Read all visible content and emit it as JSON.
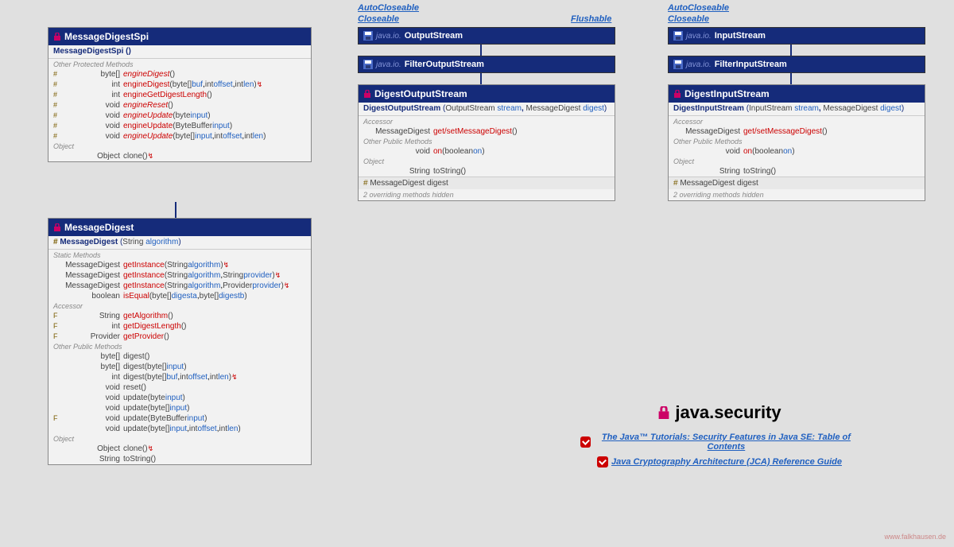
{
  "interfaces": {
    "autoCloseable1": "AutoCloseable",
    "closeable1": "Closeable",
    "flushable": "Flushable",
    "autoCloseable2": "AutoCloseable",
    "closeable2": "Closeable"
  },
  "parents": {
    "outputStream": {
      "pkg": "java.io.",
      "cls": "OutputStream"
    },
    "filterOutputStream": {
      "pkg": "java.io.",
      "cls": "FilterOutputStream"
    },
    "inputStream": {
      "pkg": "java.io.",
      "cls": "InputStream"
    },
    "filterInputStream": {
      "pkg": "java.io.",
      "cls": "FilterInputStream"
    }
  },
  "spi": {
    "title": "MessageDigestSpi",
    "constructor": "MessageDigestSpi ()",
    "protectedLabel": "Other Protected Methods",
    "objectLabel": "Object",
    "methods": {
      "engineDigest1": {
        "mod": "#",
        "ret": "byte[]",
        "name": "engineDigest",
        "args": "()",
        "italic": true
      },
      "engineDigest2": {
        "mod": "#",
        "ret": "int",
        "name": "engineDigest",
        "args_raw": "(byte[] buf, int offset, int len)",
        "throws": "↯"
      },
      "engineGetDigestLength": {
        "mod": "#",
        "ret": "int",
        "name": "engineGetDigestLength",
        "args": "()"
      },
      "engineReset": {
        "mod": "#",
        "ret": "void",
        "name": "engineReset",
        "args": "()",
        "italic": true
      },
      "engineUpdate1": {
        "mod": "#",
        "ret": "void",
        "name": "engineUpdate",
        "args_raw": "(byte input)",
        "italic": true
      },
      "engineUpdate2": {
        "mod": "#",
        "ret": "void",
        "name": "engineUpdate",
        "args_raw": "(ByteBuffer input)"
      },
      "engineUpdate3": {
        "mod": "#",
        "ret": "void",
        "name": "engineUpdate",
        "args_raw": "(byte[] input, int offset, int len)",
        "italic": true
      },
      "clone": {
        "mod": "",
        "ret": "Object",
        "name": "clone",
        "args": "()",
        "throws": "↯"
      }
    }
  },
  "digest": {
    "title": "MessageDigest",
    "constructor": "MessageDigest",
    "constructorArgs": "(String algorithm)",
    "staticLabel": "Static Methods",
    "accessorLabel": "Accessor",
    "publicLabel": "Other Public Methods",
    "objectLabel": "Object",
    "methods": {
      "getInstance1": {
        "ret": "MessageDigest",
        "name": "getInstance",
        "args": "(String algorithm)",
        "throws": "↯"
      },
      "getInstance2": {
        "ret": "MessageDigest",
        "name": "getInstance",
        "args": "(String algorithm, String provider)",
        "throws": "↯"
      },
      "getInstance3": {
        "ret": "MessageDigest",
        "name": "getInstance",
        "args": "(String algorithm, Provider provider)",
        "throws": "↯"
      },
      "isEqual": {
        "ret": "boolean",
        "name": "isEqual",
        "args": "(byte[] digesta, byte[] digestb)"
      },
      "getAlgorithm": {
        "mod": "F",
        "ret": "String",
        "name": "getAlgorithm",
        "args": "()"
      },
      "getDigestLength": {
        "mod": "F",
        "ret": "int",
        "name": "getDigestLength",
        "args": "()"
      },
      "getProvider": {
        "mod": "F",
        "ret": "Provider",
        "name": "getProvider",
        "args": "()"
      },
      "digest1": {
        "ret": "byte[]",
        "name": "digest",
        "args": "()"
      },
      "digest2": {
        "ret": "byte[]",
        "name": "digest",
        "args": "(byte[] input)"
      },
      "digest3": {
        "ret": "int",
        "name": "digest",
        "args": "(byte[] buf, int offset, int len)",
        "throws": "↯"
      },
      "reset": {
        "ret": "void",
        "name": "reset",
        "args": "()"
      },
      "update1": {
        "ret": "void",
        "name": "update",
        "args": "(byte input)"
      },
      "update2": {
        "ret": "void",
        "name": "update",
        "args": "(byte[] input)"
      },
      "update3": {
        "mod": "F",
        "ret": "void",
        "name": "update",
        "args": "(ByteBuffer input)"
      },
      "update4": {
        "ret": "void",
        "name": "update",
        "args": "(byte[] input, int offset, int len)"
      },
      "clone": {
        "ret": "Object",
        "name": "clone",
        "args": "()",
        "throws": "↯"
      },
      "toString": {
        "ret": "String",
        "name": "toString",
        "args": "()"
      }
    }
  },
  "dos": {
    "title": "DigestOutputStream",
    "constructor": "DigestOutputStream",
    "constructorArgs": "(OutputStream stream, MessageDigest digest)",
    "accessorLabel": "Accessor",
    "publicLabel": "Other Public Methods",
    "objectLabel": "Object",
    "msgDigest": {
      "ret": "MessageDigest",
      "name": "get/setMessageDigest",
      "args": "()"
    },
    "on": {
      "ret": "void",
      "name": "on",
      "args": "(boolean on)"
    },
    "toString": {
      "ret": "String",
      "name": "toString",
      "args": "()"
    },
    "field": "# MessageDigest  digest",
    "hidden": "2 overriding methods hidden"
  },
  "dis": {
    "title": "DigestInputStream",
    "constructor": "DigestInputStream",
    "constructorArgs": "(InputStream stream, MessageDigest digest)",
    "accessorLabel": "Accessor",
    "publicLabel": "Other Public Methods",
    "objectLabel": "Object",
    "msgDigest": {
      "ret": "MessageDigest",
      "name": "get/setMessageDigest",
      "args": "()"
    },
    "on": {
      "ret": "void",
      "name": "on",
      "args": "(boolean on)"
    },
    "toString": {
      "ret": "String",
      "name": "toString",
      "args": "()"
    },
    "field": "# MessageDigest  digest",
    "hidden": "2 overriding methods hidden"
  },
  "titleArea": {
    "pkg": "java.security",
    "link1": "The Java™ Tutorials: Security Features in Java SE: Table of Contents",
    "link2": "Java Cryptography Architecture (JCA) Reference Guide"
  },
  "footer": "www.falkhausen.de"
}
